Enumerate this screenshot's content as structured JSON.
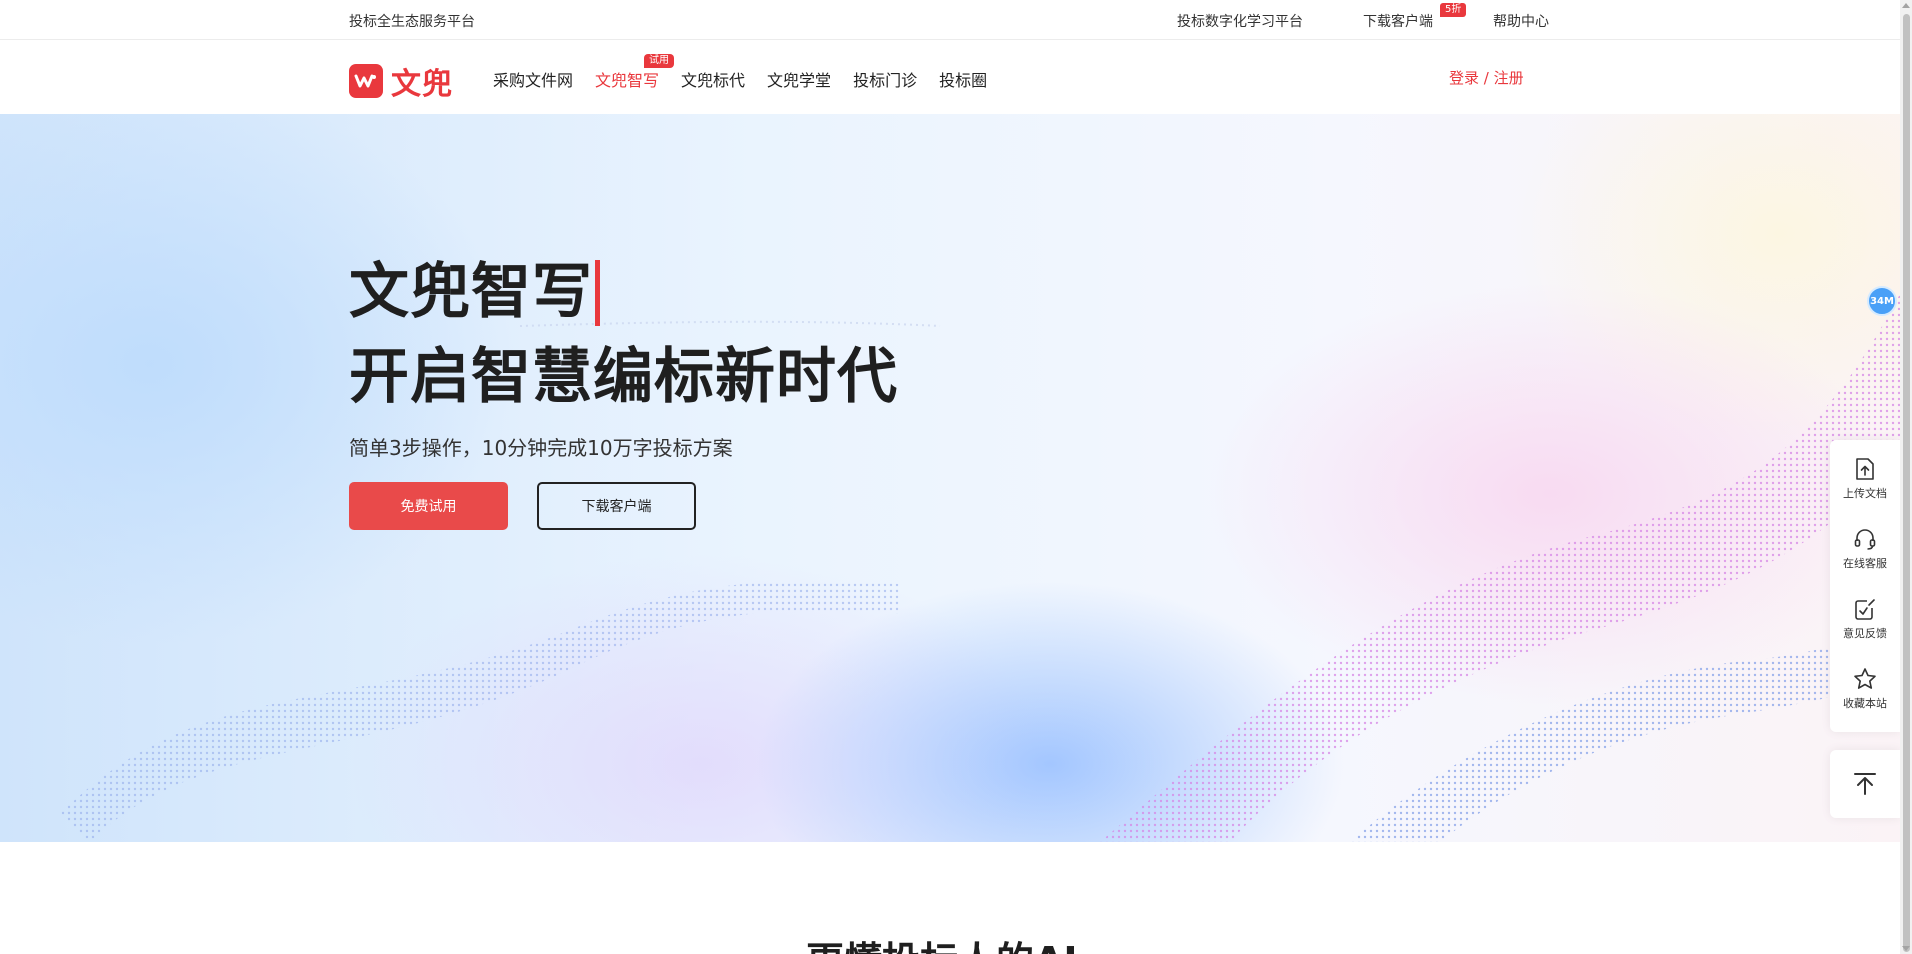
{
  "topbar": {
    "tagline": "投标全生态服务平台",
    "links": [
      "投标数字化学习平台",
      "下载客户端",
      "帮助中心"
    ],
    "download_badge": "5折"
  },
  "nav": {
    "logo_text": "文兜",
    "items": [
      "采购文件网",
      "文兜智写",
      "文兜标代",
      "文兜学堂",
      "投标门诊",
      "投标圈"
    ],
    "active_item": "文兜智写",
    "trial_badge": "试用",
    "login": "登录 / 注册"
  },
  "hero": {
    "title_line1": "文兜智写",
    "title_line2": "开启智慧编标新时代",
    "subtitle": "简单3步操作，10分钟完成10万字投标方案",
    "primary_button": "免费试用",
    "secondary_button": "下载客户端"
  },
  "float_widget": {
    "memory_bubble": "34M",
    "items": [
      {
        "label": "上传文档",
        "icon": "upload-icon"
      },
      {
        "label": "在线客服",
        "icon": "headset-icon"
      },
      {
        "label": "意见反馈",
        "icon": "feedback-icon"
      },
      {
        "label": "收藏本站",
        "icon": "star-icon"
      }
    ],
    "back_to_top_icon": "arrow-up-icon"
  },
  "section": {
    "heading": "更懂投标人的AI"
  },
  "colors": {
    "brand_red": "#e9383d",
    "button_red": "#e94a4a",
    "text_dark": "#1f1f1f"
  }
}
